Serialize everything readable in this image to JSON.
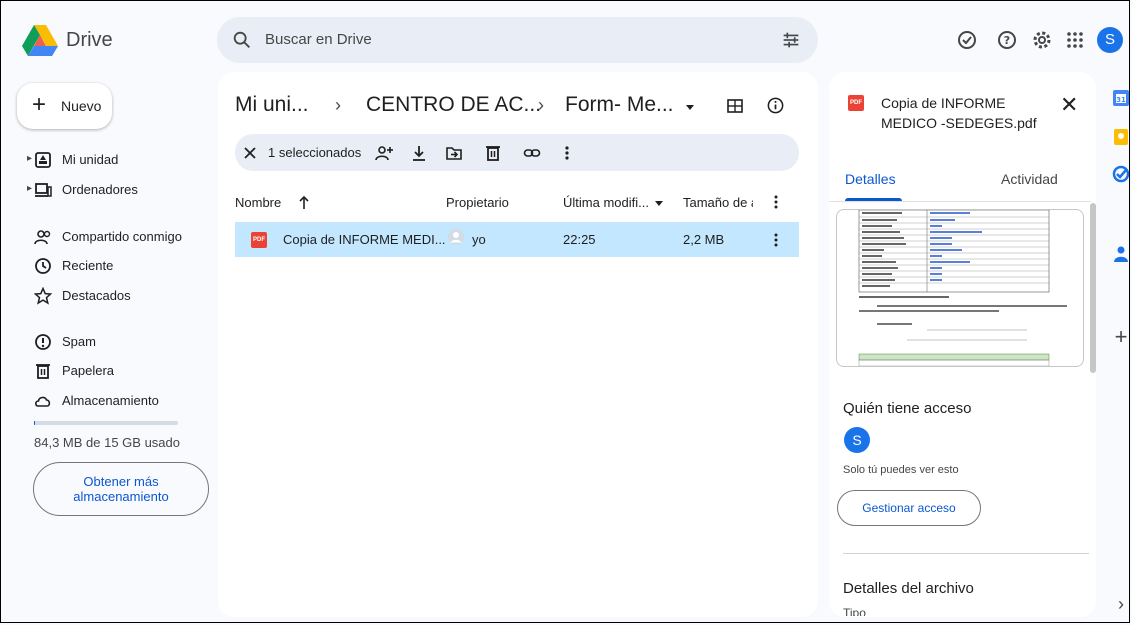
{
  "app": {
    "name": "Drive",
    "avatar_letter": "S"
  },
  "search": {
    "placeholder": "Buscar en Drive"
  },
  "sidebar": {
    "new_label": "Nuevo",
    "items": [
      {
        "label": "Mi unidad",
        "icon": "drive-icon"
      },
      {
        "label": "Ordenadores",
        "icon": "computer-icon"
      },
      {
        "label": "Compartido conmigo",
        "icon": "shared-icon"
      },
      {
        "label": "Reciente",
        "icon": "clock-icon"
      },
      {
        "label": "Destacados",
        "icon": "star-icon"
      },
      {
        "label": "Spam",
        "icon": "spam-icon"
      },
      {
        "label": "Papelera",
        "icon": "trash-icon"
      },
      {
        "label": "Almacenamiento",
        "icon": "cloud-icon"
      }
    ],
    "storage_text": "84,3 MB de 15 GB usado",
    "storage_used_fraction": 0.0055,
    "get_more_label": "Obtener más almacenamiento"
  },
  "breadcrumb": {
    "items": [
      "Mi uni...",
      "CENTRO DE AC...",
      "Form- Me..."
    ]
  },
  "selection": {
    "text": "1 seleccionados"
  },
  "table": {
    "headers": [
      "Nombre",
      "Propietario",
      "Última modifi...",
      "Tamaño de a"
    ],
    "rows": [
      {
        "name": "Copia de INFORME MEDI...",
        "owner": "yo",
        "modified": "22:25",
        "size": "2,2 MB"
      }
    ]
  },
  "details_panel": {
    "title": "Copia de INFORME MEDICO -SEDEGES.pdf",
    "tabs": [
      "Detalles",
      "Actividad"
    ],
    "access_title": "Quién tiene acceso",
    "access_avatar": "S",
    "access_note": "Solo tú puedes ver esto",
    "manage_label": "Gestionar acceso",
    "file_details_title": "Detalles del archivo",
    "type_label": "Tipo"
  },
  "colors": {
    "accent": "#0b57d0",
    "selected_row": "#c2e7ff",
    "pdf_red": "#ea4335"
  }
}
